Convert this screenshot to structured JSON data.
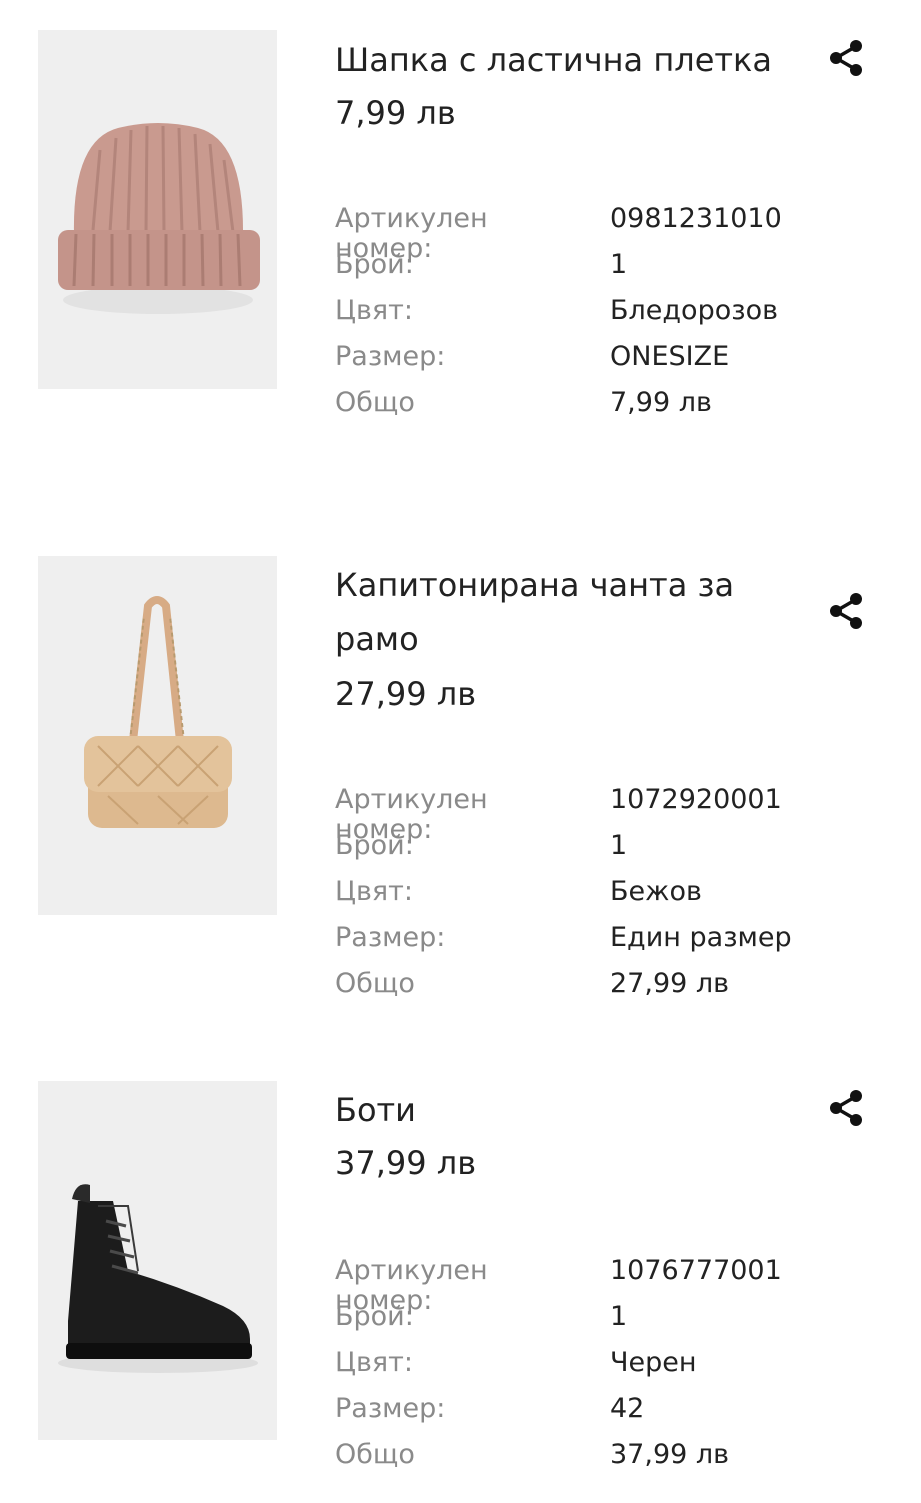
{
  "labels": {
    "article_number_line1": "Артикулен",
    "article_number_line2": "номер:",
    "quantity": "Брой:",
    "color": "Цвят:",
    "size": "Размер:",
    "total": "Общо"
  },
  "items": [
    {
      "title": "Шапка с ластична плетка",
      "price": "7,99 лв",
      "article_number": "0981231010",
      "quantity": "1",
      "color": "Бледорозов",
      "size": "ONESIZE",
      "total": "7,99 лв"
    },
    {
      "title": "Капитонирана чанта за рамо",
      "price": "27,99 лв",
      "article_number": "1072920001",
      "quantity": "1",
      "color": "Бежов",
      "size": "Един размер",
      "total": "27,99 лв"
    },
    {
      "title": "Боти",
      "price": "37,99 лв",
      "article_number": "1076777001",
      "quantity": "1",
      "color": "Черен",
      "size": "42",
      "total": "37,99 лв"
    }
  ],
  "icons": {
    "share": "share-icon"
  },
  "colors": {
    "text_primary": "#222222",
    "text_label": "#8a8a8a",
    "image_bg": "#efefef"
  }
}
